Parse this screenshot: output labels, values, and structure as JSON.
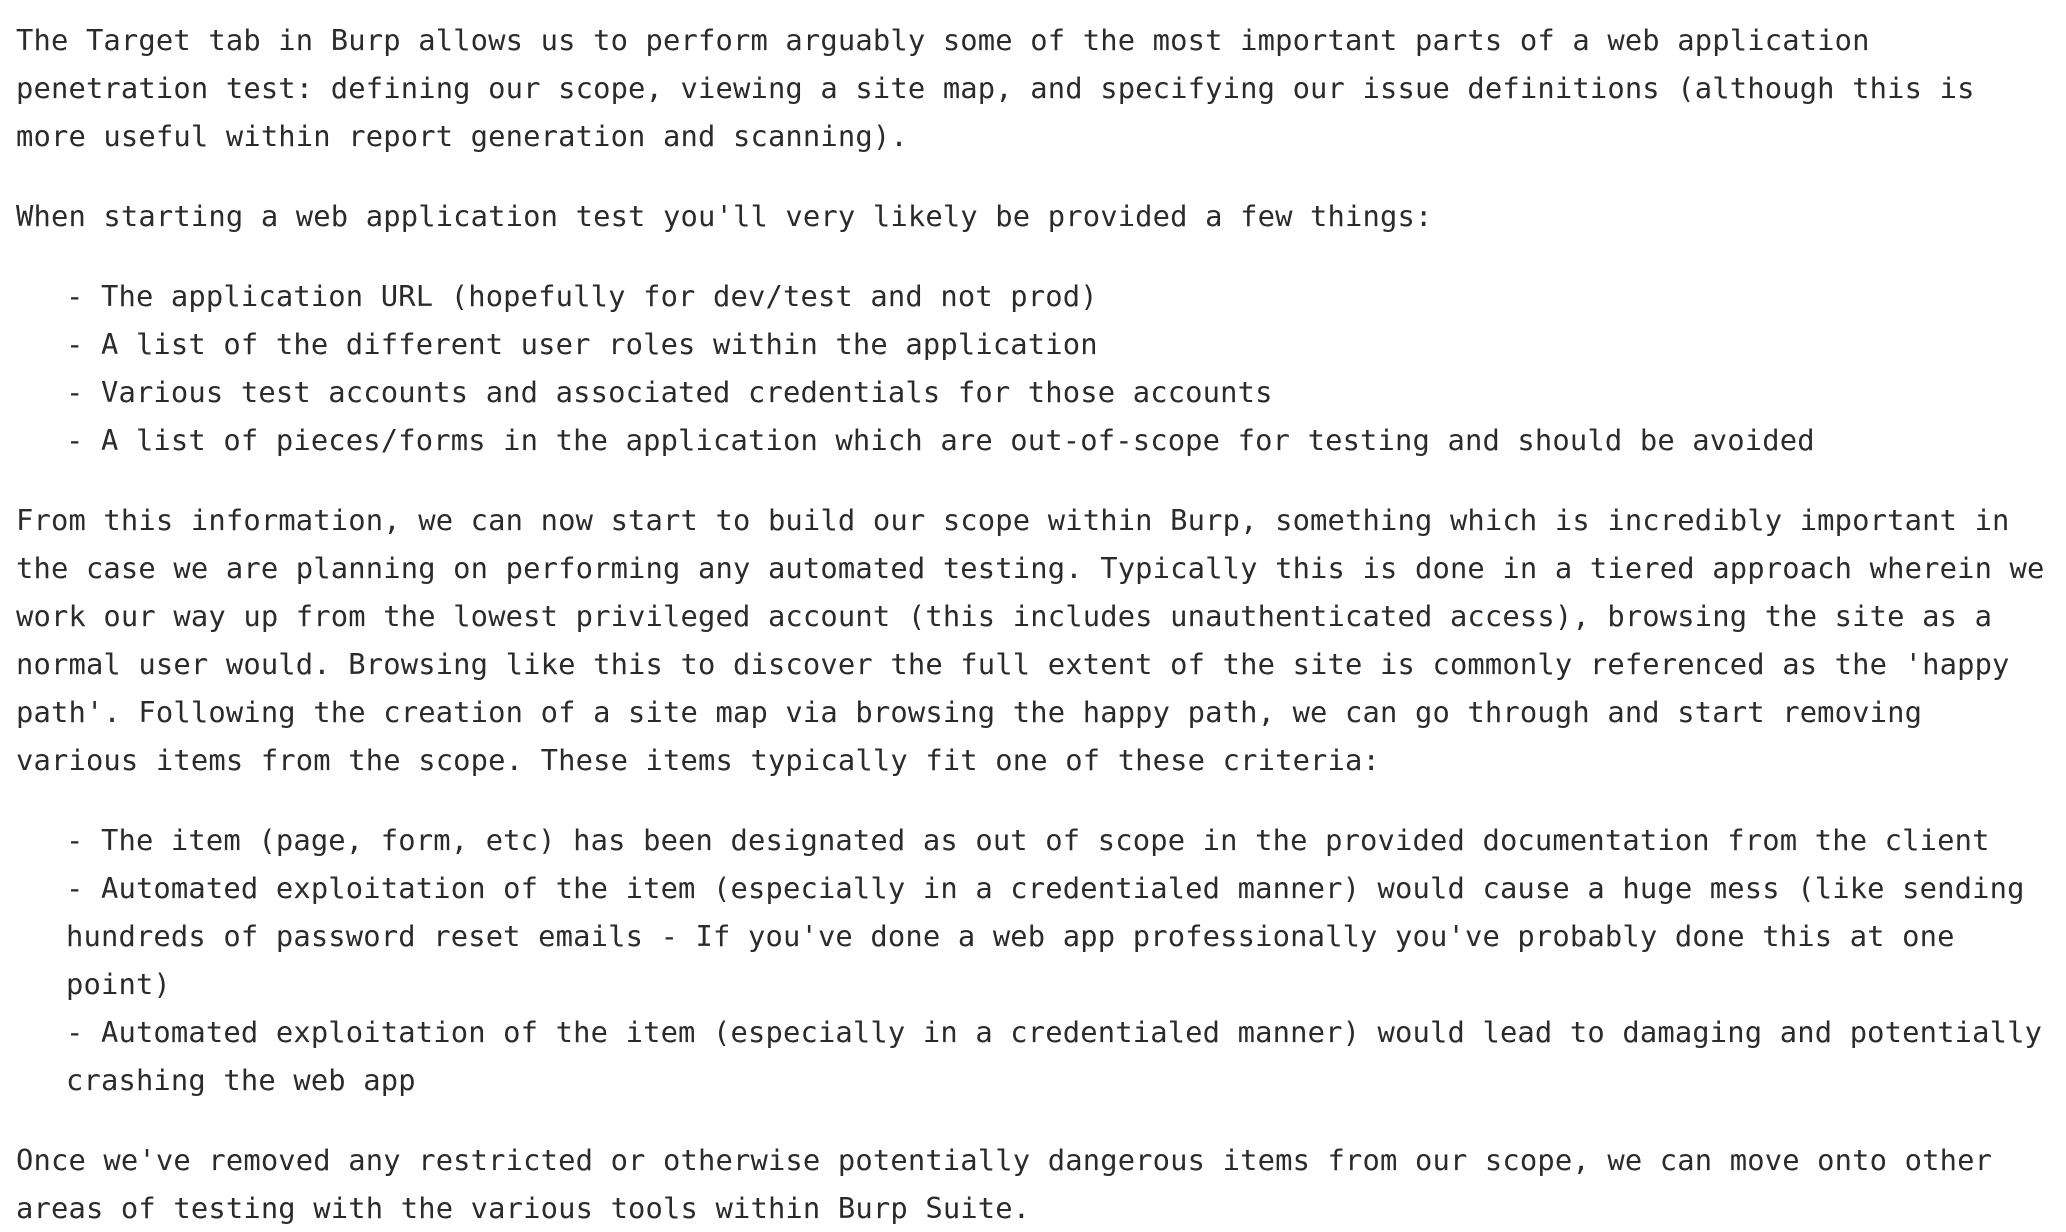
{
  "document": {
    "para1": "The Target tab in Burp allows us to perform arguably some of the most important parts of a web application penetration test: defining our scope, viewing a site map, and specifying our issue definitions (although this is more useful within report generation and scanning).",
    "para2": "When starting a web application test you'll very likely be provided a few things:",
    "list1": [
      "- The application URL (hopefully for dev/test and not prod)",
      "- A list of the different user roles within the application",
      "- Various test accounts and associated credentials for those accounts",
      "- A list of pieces/forms in the application which are out-of-scope for testing and should be avoided"
    ],
    "para3": "From this information, we can now start to build our scope within Burp, something which is incredibly important in the case we are planning on performing any automated testing. Typically this is done in a tiered approach wherein we work our way up from the lowest privileged account (this includes unauthenticated access), browsing the site as a normal user would. Browsing like this to discover the full extent of the site is commonly referenced as the 'happy path'. Following the creation of a site map via browsing the happy path, we can go through and start removing various items from the scope. These items typically fit one of these criteria:",
    "list2": [
      "- The item (page, form, etc) has been designated as out of scope in the provided documentation from the client",
      "- Automated exploitation of the item (especially in a credentialed manner) would cause a huge mess (like sending hundreds of password reset emails - If you've done a web app professionally you've probably done this at one point)",
      "- Automated exploitation of the item (especially in a credentialed manner) would lead to damaging and potentially crashing the web app"
    ],
    "para4": "Once we've removed any restricted or otherwise potentially dangerous items from our scope, we can move onto other areas of testing with the various tools within Burp Suite."
  }
}
